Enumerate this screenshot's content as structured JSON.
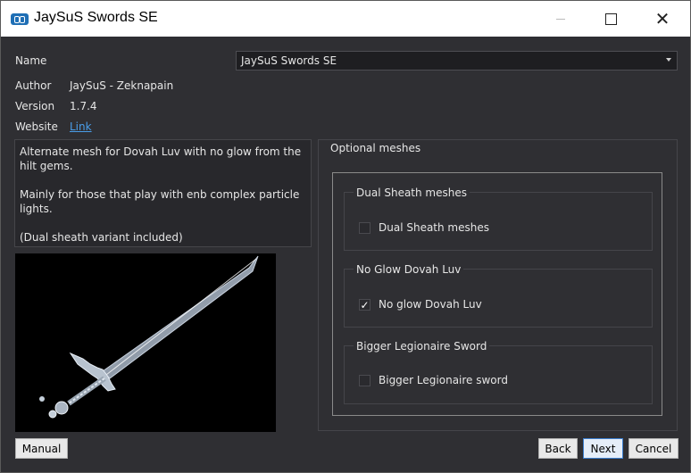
{
  "window": {
    "title": "JaySuS Swords SE",
    "icon": "app-icon"
  },
  "fields": {
    "name_label": "Name",
    "name_value": "JaySuS Swords SE",
    "author_label": "Author",
    "author_value": "JaySuS - Zeknapain",
    "version_label": "Version",
    "version_value": "1.7.4",
    "website_label": "Website",
    "website_link": "Link"
  },
  "description": {
    "line1": "Alternate mesh for Dovah Luv with no glow from the hilt gems.",
    "line2": "Mainly for those that play with enb complex particle lights.",
    "line3": "(Dual sheath variant included)"
  },
  "options": {
    "title": "Optional meshes",
    "groups": [
      {
        "title": "Dual Sheath meshes",
        "option": "Dual Sheath meshes",
        "checked": false
      },
      {
        "title": "No Glow Dovah Luv",
        "option": "No glow Dovah Luv",
        "checked": true
      },
      {
        "title": "Bigger Legionaire Sword",
        "option": "Bigger Legionaire sword",
        "checked": false
      }
    ]
  },
  "buttons": {
    "manual": "Manual",
    "back": "Back",
    "next": "Next",
    "cancel": "Cancel"
  },
  "colors": {
    "background": "#2f2f33",
    "link": "#4a9eea",
    "default_button_border": "#3c7fd0"
  }
}
